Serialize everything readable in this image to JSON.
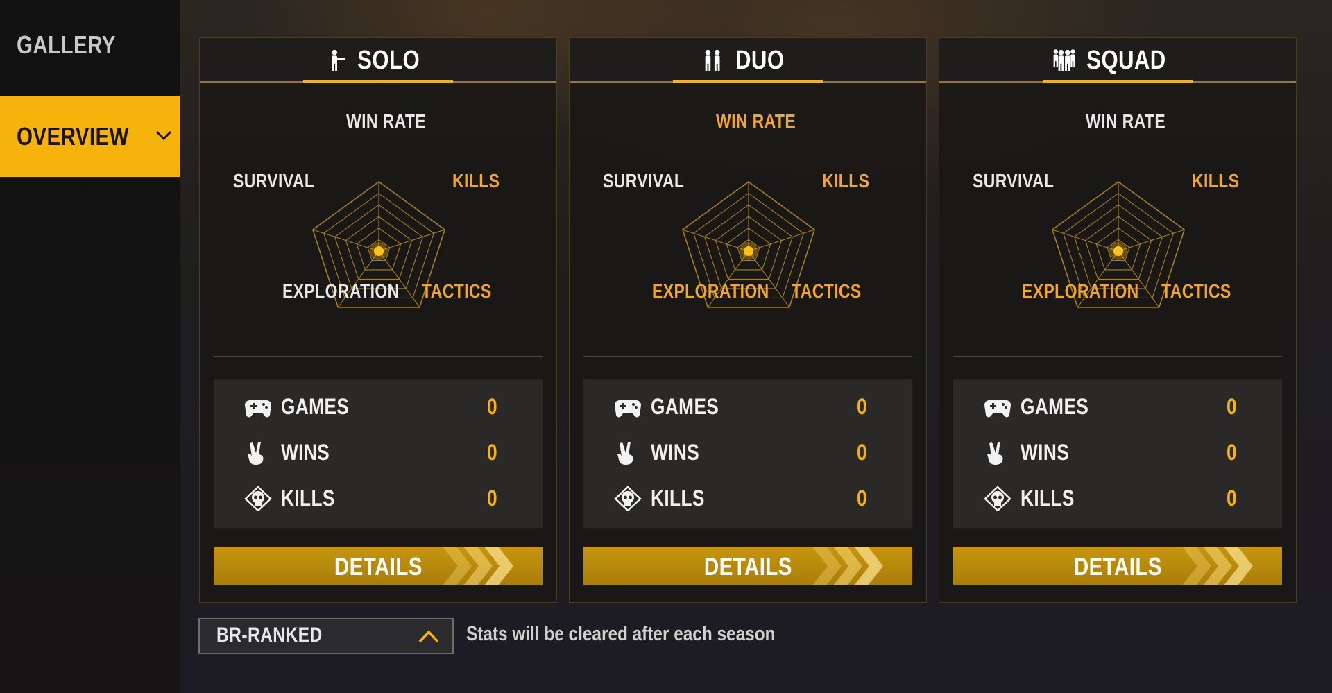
{
  "sidebar": {
    "items": [
      {
        "label": "GALLERY",
        "active": false
      },
      {
        "label": "OVERVIEW",
        "active": true,
        "icon": "chevron-down-icon"
      }
    ]
  },
  "panels": [
    {
      "title": "SOLO",
      "icon": "solo-player-icon",
      "radar": {
        "win_rate": "WIN RATE",
        "kills": "KILLS",
        "tactics": "TACTICS",
        "exploration": "EXPLORATION",
        "survival": "SURVIVAL",
        "highlighted": [
          "KILLS",
          "TACTICS"
        ]
      },
      "stats": [
        {
          "label": "GAMES",
          "value": "0",
          "icon": "gamepad-icon"
        },
        {
          "label": "WINS",
          "value": "0",
          "icon": "victory-hand-icon"
        },
        {
          "label": "KILLS",
          "value": "0",
          "icon": "skull-icon"
        }
      ],
      "details_label": "DETAILS"
    },
    {
      "title": "DUO",
      "icon": "duo-players-icon",
      "radar": {
        "win_rate": "WIN RATE",
        "kills": "KILLS",
        "tactics": "TACTICS",
        "exploration": "EXPLORATION",
        "survival": "SURVIVAL",
        "highlighted": [
          "WIN RATE",
          "KILLS",
          "TACTICS",
          "EXPLORATION"
        ]
      },
      "stats": [
        {
          "label": "GAMES",
          "value": "0",
          "icon": "gamepad-icon"
        },
        {
          "label": "WINS",
          "value": "0",
          "icon": "victory-hand-icon"
        },
        {
          "label": "KILLS",
          "value": "0",
          "icon": "skull-icon"
        }
      ],
      "details_label": "DETAILS"
    },
    {
      "title": "SQUAD",
      "icon": "squad-players-icon",
      "radar": {
        "win_rate": "WIN RATE",
        "kills": "KILLS",
        "tactics": "TACTICS",
        "exploration": "EXPLORATION",
        "survival": "SURVIVAL",
        "highlighted": [
          "KILLS",
          "TACTICS",
          "EXPLORATION"
        ]
      },
      "stats": [
        {
          "label": "GAMES",
          "value": "0",
          "icon": "gamepad-icon"
        },
        {
          "label": "WINS",
          "value": "0",
          "icon": "victory-hand-icon"
        },
        {
          "label": "KILLS",
          "value": "0",
          "icon": "skull-icon"
        }
      ],
      "details_label": "DETAILS"
    }
  ],
  "footer": {
    "mode_select_value": "BR-RANKED",
    "mode_select_icon": "chevron-up-icon",
    "season_note": "Stats will be cleared after each season"
  },
  "colors": {
    "accent": "#f6b30c",
    "label_gold": "#f2a72a",
    "radar_line": "#a8801c"
  }
}
